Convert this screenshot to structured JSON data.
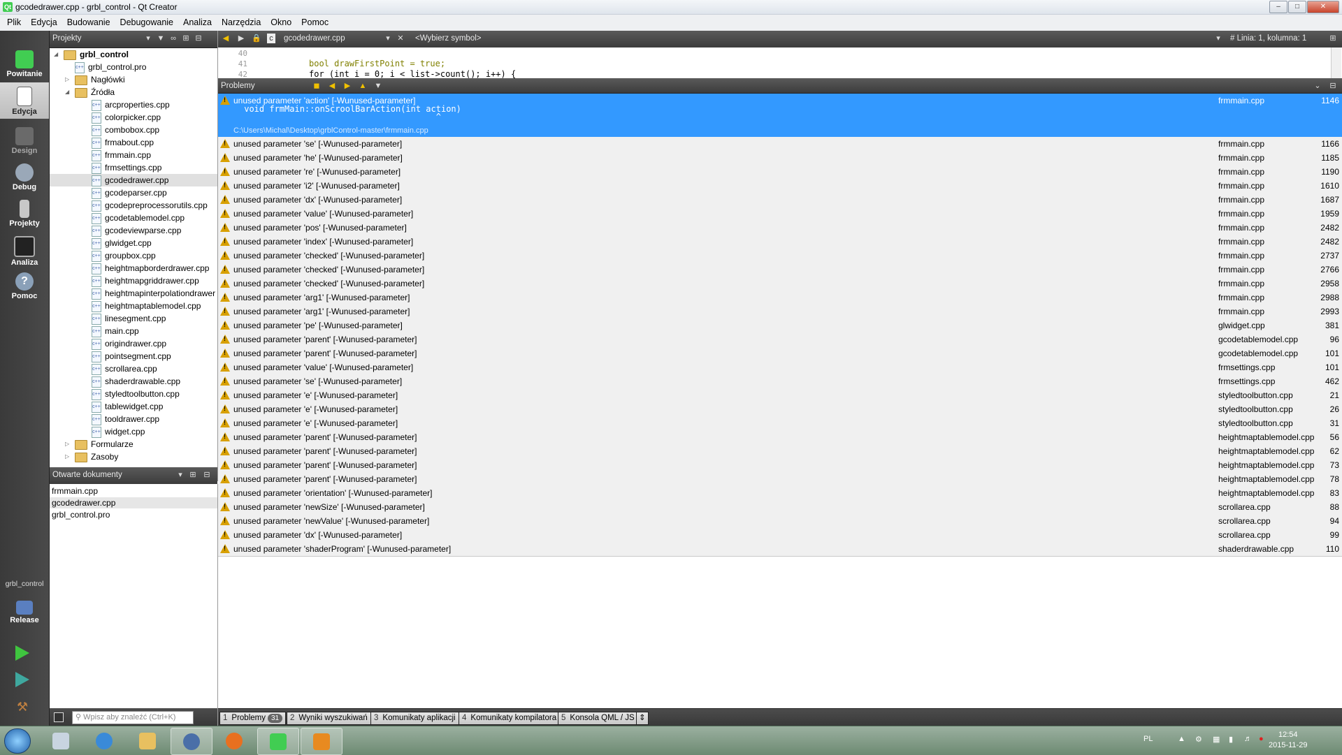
{
  "window": {
    "title": "gcodedrawer.cpp - grbl_control - Qt Creator",
    "title_icon": "qt-logo-icon"
  },
  "menu": [
    "Plik",
    "Edycja",
    "Budowanie",
    "Debugowanie",
    "Analiza",
    "Narzędzia",
    "Okno",
    "Pomoc"
  ],
  "modes": [
    {
      "label": "Powitanie",
      "icon": "qt-welcome-icon"
    },
    {
      "label": "Edycja",
      "icon": "edit-document-icon"
    },
    {
      "label": "Design",
      "icon": "design-pencil-icon"
    },
    {
      "label": "Debug",
      "icon": "debug-bug-icon"
    },
    {
      "label": "Projekty",
      "icon": "projects-wrench-icon"
    },
    {
      "label": "Analiza",
      "icon": "analyze-monitor-icon"
    },
    {
      "label": "Pomoc",
      "icon": "help-question-icon"
    }
  ],
  "kit": {
    "project": "grbl_control",
    "config": "Release"
  },
  "projects_panel": {
    "title": "Projekty",
    "root": "grbl_control",
    "pro_file": "grbl_control.pro",
    "headers": "Nagłówki",
    "sources": "Źródła",
    "files": [
      "arcproperties.cpp",
      "colorpicker.cpp",
      "combobox.cpp",
      "frmabout.cpp",
      "frmmain.cpp",
      "frmsettings.cpp",
      "gcodedrawer.cpp",
      "gcodeparser.cpp",
      "gcodepreprocessorutils.cpp",
      "gcodetablemodel.cpp",
      "gcodeviewparse.cpp",
      "glwidget.cpp",
      "groupbox.cpp",
      "heightmapborderdrawer.cpp",
      "heightmapgriddrawer.cpp",
      "heightmapinterpolationdrawer",
      "heightmaptablemodel.cpp",
      "linesegment.cpp",
      "main.cpp",
      "origindrawer.cpp",
      "pointsegment.cpp",
      "scrollarea.cpp",
      "shaderdrawable.cpp",
      "styledtoolbutton.cpp",
      "tablewidget.cpp",
      "tooldrawer.cpp",
      "widget.cpp"
    ],
    "forms": "Formularze",
    "resources": "Zasoby"
  },
  "open_docs": {
    "title": "Otwarte dokumenty",
    "items": [
      "frmmain.cpp",
      "gcodedrawer.cpp",
      "grbl_control.pro"
    ]
  },
  "editor": {
    "file_combo": "gcodedrawer.cpp",
    "symbol_combo": "<Wybierz symbol>",
    "position": "# Linia: 1, kolumna: 1",
    "lines": [
      {
        "num": "40",
        "code": ""
      },
      {
        "num": "41",
        "code": "bool drawFirstPoint = true;"
      },
      {
        "num": "42",
        "code": "for (int i = 0; i < list->count(); i++) {"
      }
    ]
  },
  "problems": {
    "title": "Problemy",
    "selected": {
      "msg": "unused parameter 'action' [-Wunused-parameter]",
      "code": " void frmMain::onScroolBarAction(int action)",
      "caret": "                                       ^",
      "path": "C:\\Users\\Michal\\Desktop\\grblControl-master\\frmmain.cpp",
      "file": "frmmain.cpp",
      "line": "1146"
    },
    "rows": [
      {
        "msg": "unused parameter 'se' [-Wunused-parameter]",
        "file": "frmmain.cpp",
        "line": "1166"
      },
      {
        "msg": "unused parameter 'he' [-Wunused-parameter]",
        "file": "frmmain.cpp",
        "line": "1185"
      },
      {
        "msg": "unused parameter 're' [-Wunused-parameter]",
        "file": "frmmain.cpp",
        "line": "1190"
      },
      {
        "msg": "unused parameter 'i2' [-Wunused-parameter]",
        "file": "frmmain.cpp",
        "line": "1610"
      },
      {
        "msg": "unused parameter 'dx' [-Wunused-parameter]",
        "file": "frmmain.cpp",
        "line": "1687"
      },
      {
        "msg": "unused parameter 'value' [-Wunused-parameter]",
        "file": "frmmain.cpp",
        "line": "1959"
      },
      {
        "msg": "unused parameter 'pos' [-Wunused-parameter]",
        "file": "frmmain.cpp",
        "line": "2482"
      },
      {
        "msg": "unused parameter 'index' [-Wunused-parameter]",
        "file": "frmmain.cpp",
        "line": "2482"
      },
      {
        "msg": "unused parameter 'checked' [-Wunused-parameter]",
        "file": "frmmain.cpp",
        "line": "2737"
      },
      {
        "msg": "unused parameter 'checked' [-Wunused-parameter]",
        "file": "frmmain.cpp",
        "line": "2766"
      },
      {
        "msg": "unused parameter 'checked' [-Wunused-parameter]",
        "file": "frmmain.cpp",
        "line": "2958"
      },
      {
        "msg": "unused parameter 'arg1' [-Wunused-parameter]",
        "file": "frmmain.cpp",
        "line": "2988"
      },
      {
        "msg": "unused parameter 'arg1' [-Wunused-parameter]",
        "file": "frmmain.cpp",
        "line": "2993"
      },
      {
        "msg": "unused parameter 'pe' [-Wunused-parameter]",
        "file": "glwidget.cpp",
        "line": "381"
      },
      {
        "msg": "unused parameter 'parent' [-Wunused-parameter]",
        "file": "gcodetablemodel.cpp",
        "line": "96"
      },
      {
        "msg": "unused parameter 'parent' [-Wunused-parameter]",
        "file": "gcodetablemodel.cpp",
        "line": "101"
      },
      {
        "msg": "unused parameter 'value' [-Wunused-parameter]",
        "file": "frmsettings.cpp",
        "line": "101"
      },
      {
        "msg": "unused parameter 'se' [-Wunused-parameter]",
        "file": "frmsettings.cpp",
        "line": "462"
      },
      {
        "msg": "unused parameter 'e' [-Wunused-parameter]",
        "file": "styledtoolbutton.cpp",
        "line": "21"
      },
      {
        "msg": "unused parameter 'e' [-Wunused-parameter]",
        "file": "styledtoolbutton.cpp",
        "line": "26"
      },
      {
        "msg": "unused parameter 'e' [-Wunused-parameter]",
        "file": "styledtoolbutton.cpp",
        "line": "31"
      },
      {
        "msg": "unused parameter 'parent' [-Wunused-parameter]",
        "file": "heightmaptablemodel.cpp",
        "line": "56"
      },
      {
        "msg": "unused parameter 'parent' [-Wunused-parameter]",
        "file": "heightmaptablemodel.cpp",
        "line": "62"
      },
      {
        "msg": "unused parameter 'parent' [-Wunused-parameter]",
        "file": "heightmaptablemodel.cpp",
        "line": "73"
      },
      {
        "msg": "unused parameter 'parent' [-Wunused-parameter]",
        "file": "heightmaptablemodel.cpp",
        "line": "78"
      },
      {
        "msg": "unused parameter 'orientation' [-Wunused-parameter]",
        "file": "heightmaptablemodel.cpp",
        "line": "83"
      },
      {
        "msg": "unused parameter 'newSize' [-Wunused-parameter]",
        "file": "scrollarea.cpp",
        "line": "88"
      },
      {
        "msg": "unused parameter 'newValue' [-Wunused-parameter]",
        "file": "scrollarea.cpp",
        "line": "94"
      },
      {
        "msg": "unused parameter 'dx' [-Wunused-parameter]",
        "file": "scrollarea.cpp",
        "line": "99"
      },
      {
        "msg": "unused parameter 'shaderProgram' [-Wunused-parameter]",
        "file": "shaderdrawable.cpp",
        "line": "110"
      }
    ]
  },
  "bottom": {
    "search_placeholder": "Wpisz aby znaleźć (Ctrl+K)",
    "tabs": [
      {
        "num": "1",
        "label": "Problemy",
        "badge": "31"
      },
      {
        "num": "2",
        "label": "Wyniki wyszukiwań",
        "badge": ""
      },
      {
        "num": "3",
        "label": "Komunikaty aplikacji",
        "badge": ""
      },
      {
        "num": "4",
        "label": "Komunikaty kompilatora",
        "badge": ""
      },
      {
        "num": "5",
        "label": "Konsola QML / JS",
        "badge": ""
      }
    ]
  },
  "taskbar": {
    "language": "PL",
    "time": "12:54",
    "date": "2015-11-29"
  },
  "colors": {
    "selection": "#3399ff",
    "warning": "#d8a000",
    "modebar": "#404040"
  }
}
